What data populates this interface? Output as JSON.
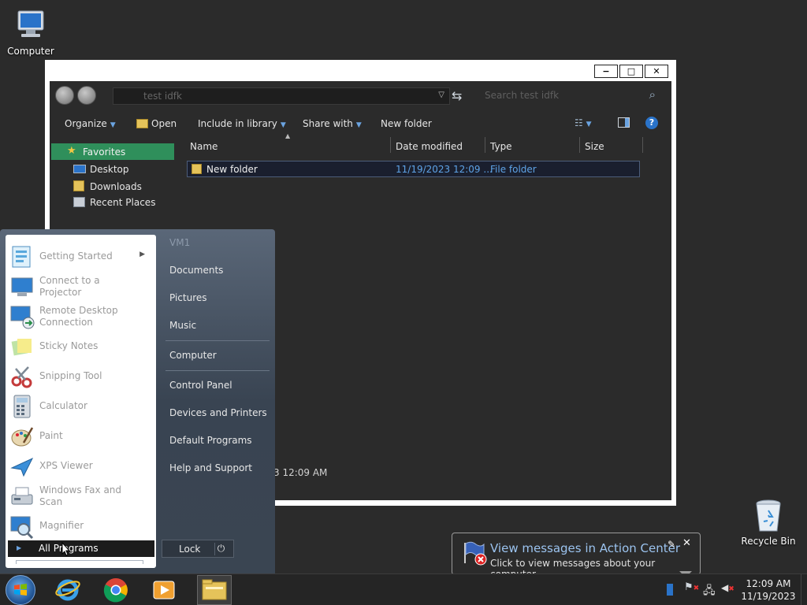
{
  "desktop": {
    "computer_label": "Computer",
    "recycle_label": "Recycle Bin"
  },
  "explorer": {
    "min_glyph": "−",
    "max_glyph": "□",
    "close_glyph": "✕",
    "address_text": "test idfk",
    "search_placeholder": "Search test idfk",
    "toolbar": {
      "organize": "Organize",
      "open": "Open",
      "include": "Include in library",
      "share": "Share with",
      "new_folder": "New folder"
    },
    "nav": {
      "favorites": "Favorites",
      "desktop": "Desktop",
      "downloads": "Downloads",
      "recent": "Recent Places"
    },
    "columns": {
      "name": "Name",
      "date": "Date modified",
      "type": "Type",
      "size": "Size"
    },
    "row": {
      "name": "New folder",
      "date": "11/19/2023 12:09 ...",
      "type": "File folder"
    },
    "details_fragment": "3 12:09 AM"
  },
  "startmenu": {
    "programs": [
      {
        "label": "Getting Started"
      },
      {
        "label": "Connect to a\nProjector"
      },
      {
        "label": "Remote Desktop\nConnection"
      },
      {
        "label": "Sticky Notes"
      },
      {
        "label": "Snipping Tool"
      },
      {
        "label": "Calculator"
      },
      {
        "label": "Paint"
      },
      {
        "label": "XPS Viewer"
      },
      {
        "label": "Windows Fax and\nScan"
      },
      {
        "label": "Magnifier"
      }
    ],
    "all_programs": "All Programs",
    "user": "VM1",
    "right": {
      "documents": "Documents",
      "pictures": "Pictures",
      "music": "Music",
      "computer": "Computer",
      "control_panel": "Control Panel",
      "devices": "Devices and Printers",
      "defaults": "Default Programs",
      "help": "Help and Support"
    },
    "lock": "Lock"
  },
  "notification": {
    "title": "View messages in Action Center",
    "body": "Click to view messages about your computer."
  },
  "tray": {
    "time": "12:09 AM",
    "date": "11/19/2023"
  },
  "colors": {
    "accent_green": "#2f8f5b",
    "link_blue": "#5ea3e6",
    "select_blue": "#1a1f2e"
  }
}
